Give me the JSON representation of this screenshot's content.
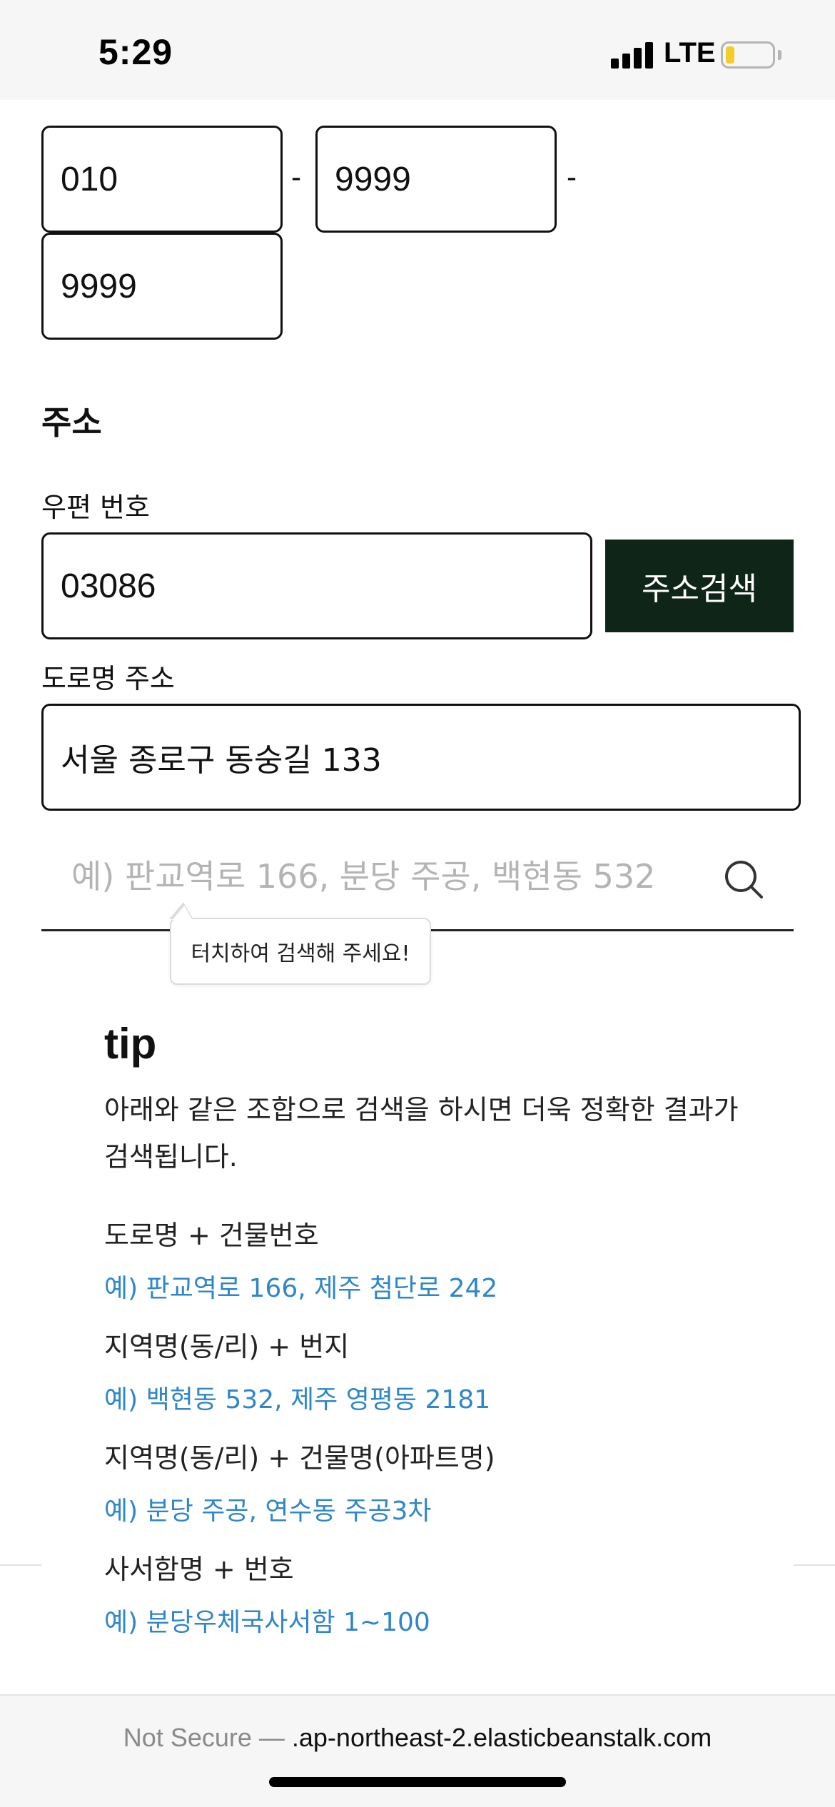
{
  "status_bar": {
    "time": "5:29",
    "network": "LTE",
    "battery_level": 0.2,
    "battery_color": "#f5cd28"
  },
  "phone": {
    "part1": "010",
    "part2": "9999",
    "part3": "9999",
    "separator": "-"
  },
  "address": {
    "section_title": "주소",
    "zip_label": "우편 번호",
    "zip_value": "03086",
    "search_button": "주소검색",
    "road_label": "도로명 주소",
    "road_value": "서울 종로구 동숭길 133"
  },
  "search": {
    "placeholder": "예) 판교역로 166, 분당 주공, 백현동 532",
    "icon": "search-icon",
    "tooltip": "터치하여 검색해 주세요!"
  },
  "tip": {
    "title": "tip",
    "description": "아래와 같은 조합으로 검색을 하시면 더욱 정확한 결과가 검색됩니다.",
    "items": [
      {
        "title": "도로명 + 건물번호",
        "example": "예) 판교역로 166,  제주 첨단로 242"
      },
      {
        "title": "지역명(동/리) + 번지",
        "example": "예) 백현동 532,  제주 영평동 2181"
      },
      {
        "title": "지역명(동/리) + 건물명(아파트명)",
        "example": "예) 분당 주공,  연수동 주공3차"
      },
      {
        "title": "사서함명 + 번호",
        "example": "예) 분당우체국사서함 1~100"
      }
    ],
    "example_color": "#2f86c8"
  },
  "browser": {
    "security": "Not Secure — ",
    "url": ".ap-northeast-2.elasticbeanstalk.com"
  },
  "colors": {
    "button_bg": "#0f2517"
  }
}
